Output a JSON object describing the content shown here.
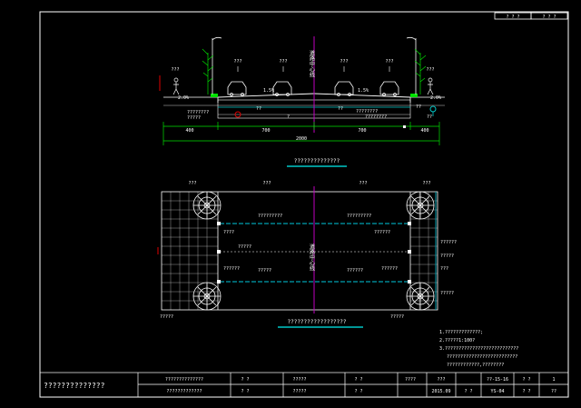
{
  "colors": {
    "background": "#000000",
    "line": "#ffffff",
    "cyan": "#00c8c8",
    "green": "#00e000",
    "red": "#e00000",
    "magenta": "#c000c0",
    "pipe_cyan": "#00a0b0"
  },
  "top_right_boxes": [
    "? ? ?",
    "? ? ?"
  ],
  "section": {
    "centerline_label": "道路中心线",
    "labels_top": [
      "???",
      "???",
      "???",
      "???"
    ],
    "side_labels": [
      "???",
      "???"
    ],
    "slope_labels": [
      "1.5%",
      "1.5%",
      "2.0%",
      "2.0%"
    ],
    "annotations": [
      "????????",
      "?????",
      "??",
      "??",
      "??",
      "????????",
      "????????",
      "??",
      "?"
    ],
    "dims": [
      "400",
      "700",
      "700",
      "400"
    ],
    "total_dim": "2000",
    "title": "??????????????"
  },
  "plan": {
    "centerline_label": "道路中心线",
    "top_labels": [
      "???",
      "???",
      "???",
      "???"
    ],
    "pipe_labels": [
      "?????????",
      "?????????",
      "????",
      "?????",
      "??????",
      "?????",
      "??????",
      "??????",
      "??????"
    ],
    "right_labels": [
      "??????",
      "?????",
      "???",
      "?????"
    ],
    "bottom_labels": [
      "?????",
      "?????"
    ],
    "title": "??????????????????"
  },
  "notes": [
    "1.?????????????;",
    "2.?????1:100?",
    "3.???????????????????????????",
    "??????????????????????????",
    "????????????,????????"
  ],
  "title_block": {
    "company": "??????????????",
    "row1": [
      "??????????????",
      "? ?",
      "?????",
      "? ?",
      "????",
      "???",
      "??-15-16",
      "? ?",
      "1"
    ],
    "row2": [
      "?????????????",
      "? ?",
      "?????",
      "? ?",
      "",
      "2015.09",
      "? ?",
      "YS-04",
      "? ?",
      "??"
    ]
  }
}
